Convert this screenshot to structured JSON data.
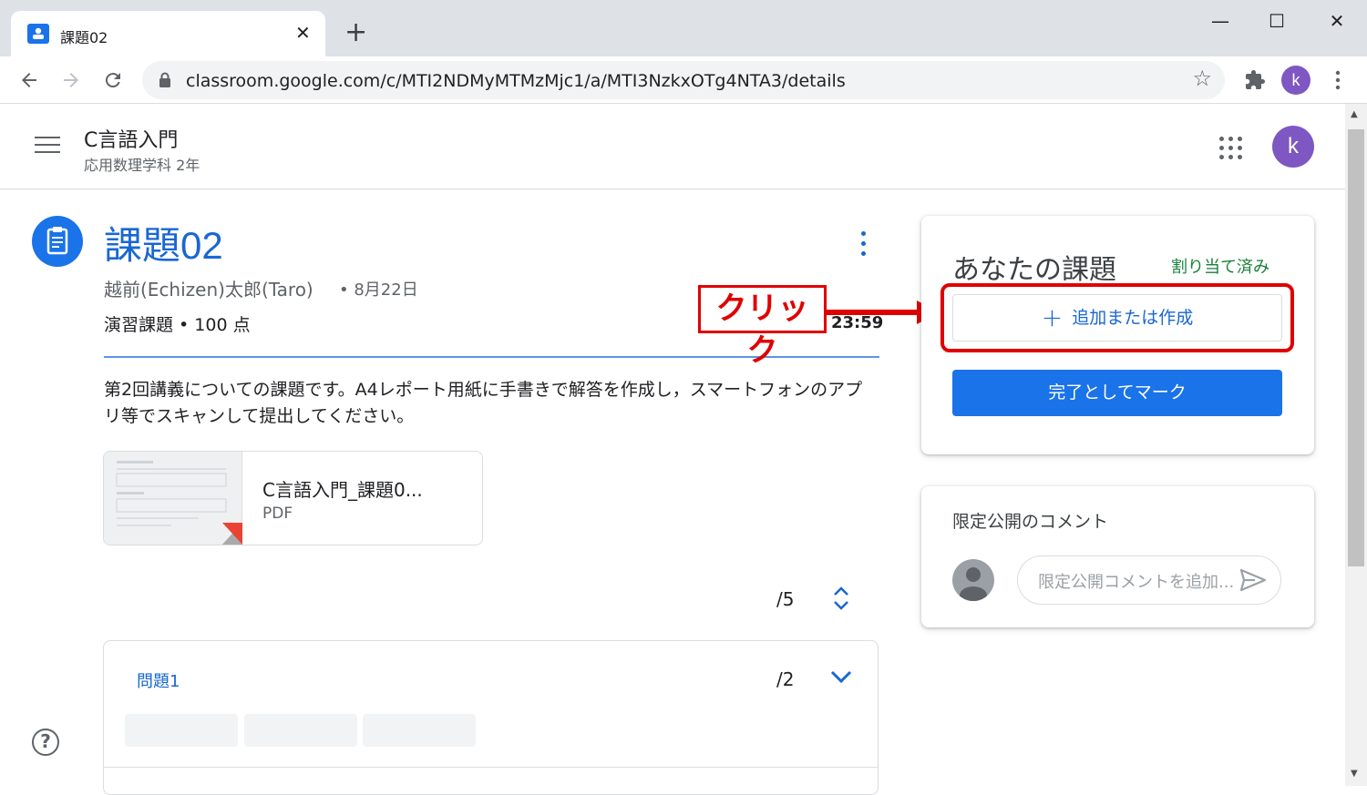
{
  "browser": {
    "tab_title": "課題02",
    "tab_close": "✕",
    "new_tab": "+",
    "window_controls": {
      "minimize": "—",
      "maximize": "☐",
      "close": "✕"
    },
    "url": "classroom.google.com/c/MTI2NDMyMTMzMjc1/a/MTI3NzkxOTg4NTA3/details",
    "profile_initial": "k"
  },
  "header": {
    "course_title": "C言語入門",
    "course_subtitle": "応用数理学科 2年",
    "account_initial": "k"
  },
  "assignment": {
    "title": "課題02",
    "author": "越前(Echizen)太郎(Taro)",
    "date": "• 8月22日",
    "points": "演習課題 • 100 点",
    "due": "23:59",
    "description": "第2回講義についての課題です。A4レポート用紙に手書きで解答を作成し，スマートフォンのアプリ等でスキャンして提出してください。",
    "attachment": {
      "name": "C言語入門_課題0...",
      "type": "PDF"
    },
    "score_total": "/5",
    "question": {
      "title": "問題1",
      "score": "/2"
    }
  },
  "annotation": {
    "label": "クリック"
  },
  "your_work": {
    "title": "あなたの課題",
    "status": "割り当て済み",
    "add_button": "追加または作成",
    "add_plus": "+",
    "done_button": "完了としてマーク"
  },
  "private_comment": {
    "title": "限定公開のコメント",
    "placeholder": "限定公開コメントを追加..."
  },
  "help": {
    "symbol": "?"
  },
  "colors": {
    "accent": "#1a73e8",
    "link": "#1967d2",
    "status_green": "#188038",
    "annotation_red": "#e00000",
    "avatar_purple": "#7e57c2"
  }
}
